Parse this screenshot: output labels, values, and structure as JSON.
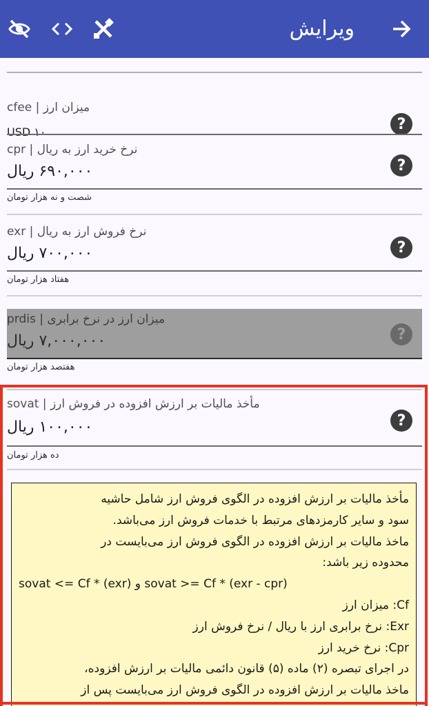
{
  "appbar": {
    "title": "ویرایش",
    "icons": [
      "visibility-off-icon",
      "code-icon",
      "tools-icon",
      "arrow-forward-icon"
    ]
  },
  "fields": [
    {
      "label": "میزان ارز | cfee",
      "value": "USD ۱۰",
      "hint": ""
    },
    {
      "label": "نرخ خرید ارز به ریال | cpr",
      "value": "۶۹۰,۰۰۰ ریال",
      "hint": "شصت و نه هزار تومان"
    },
    {
      "label": "نرخ فروش ارز به ریال | exr",
      "value": "۷۰۰,۰۰۰ ریال",
      "hint": "هفتاد هزار تومان"
    },
    {
      "label": "میزان ارز در نرخ برابری | prdis",
      "value": "۷,۰۰۰,۰۰۰ ریال",
      "hint": "هفتصد هزار تومان"
    },
    {
      "label": "مأخذ مالیات بر ارزش افزوده در فروش ارز | sovat",
      "value": "۱۰۰,۰۰۰ ریال",
      "hint": "ده هزار تومان"
    }
  ],
  "info": {
    "lines": [
      "مأخذ مالیات بر ارزش افزوده در الگوی فروش ارز شامل حاشیه",
      "سود و سایر کارمزدهای مرتبط با خدمات فروش ارز می‌باشد.",
      "ماخذ مالیات بر ارزش افزوده در الگوی فروش ارز می‌بایست در",
      "محدوده زیر باشد:",
      "sovat <= Cf * (exr) و sovat >= Cf * (exr - cpr)",
      "Cf: میزان ارز",
      "Exr: نرخ برابری ارز با ریال / نرخ فروش ارز",
      "Cpr: نرخ خرید ارز",
      "در اجرای تبصره (۲) ماده (۵) قانون دائمی مالیات بر ارزش افزوده،",
      "ماخذ مالیات بر ارزش افزوده در الگوی فروش ارز می‌بایست پس از"
    ]
  },
  "help_label": "?"
}
